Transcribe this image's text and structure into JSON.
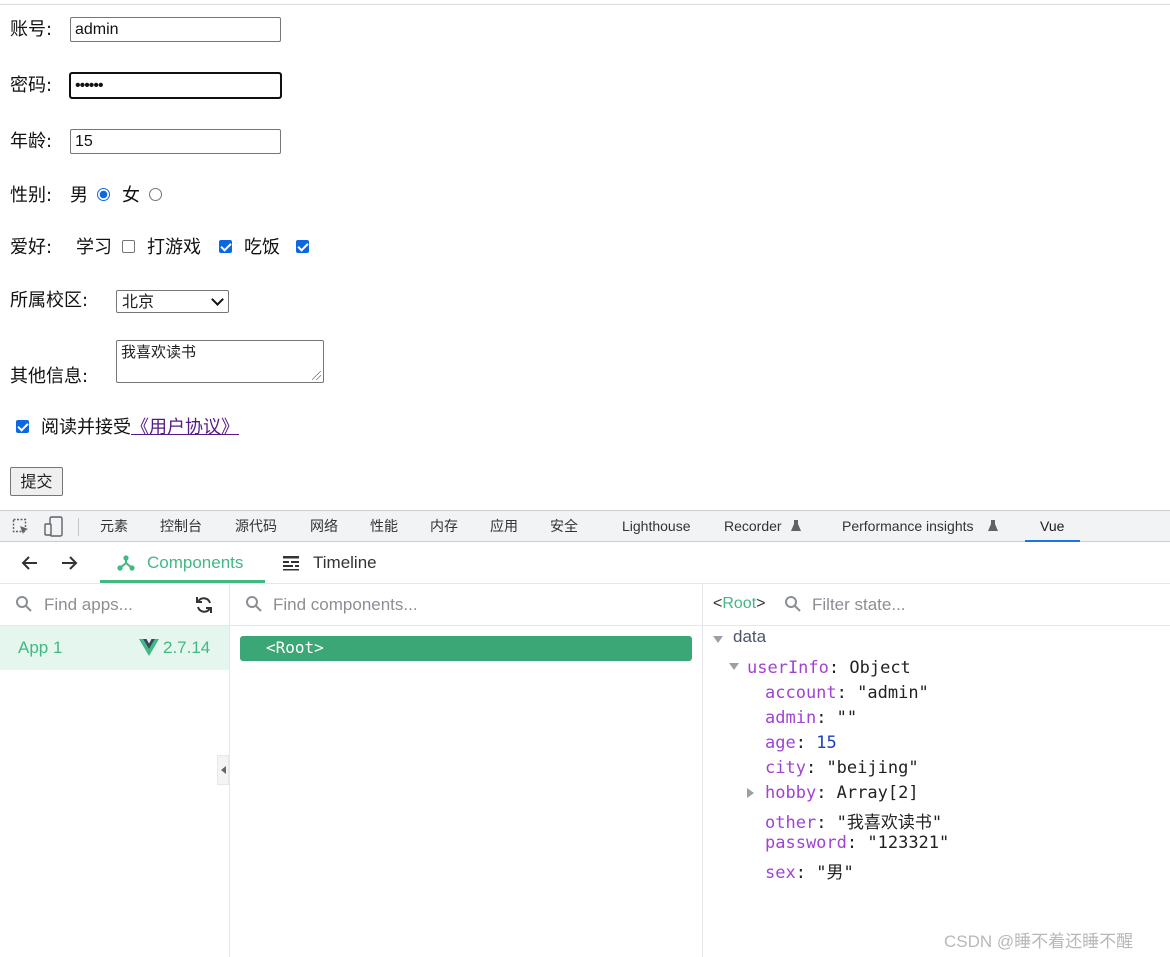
{
  "form": {
    "account_label": "账号:",
    "account_value": "admin",
    "password_label": "密码:",
    "password_value": "••••••",
    "age_label": "年龄:",
    "age_value": "15",
    "sex_label": "性别:",
    "sex_options": [
      "男",
      "女"
    ],
    "sex_selected": "男",
    "hobby_label": "爱好:",
    "hobby_options": [
      {
        "label": "学习",
        "checked": false
      },
      {
        "label": "打游戏",
        "checked": true
      },
      {
        "label": "吃饭",
        "checked": true
      }
    ],
    "city_label": "所属校区:",
    "city_value": "北京",
    "other_label": "其他信息:",
    "other_value": "我喜欢读书",
    "agree_text": "阅读并接受",
    "agree_link": "《用户协议》",
    "agree_checked": true,
    "submit_label": "提交"
  },
  "devtools": {
    "tabs": [
      "元素",
      "控制台",
      "源代码",
      "网络",
      "性能",
      "内存",
      "应用",
      "安全",
      "Lighthouse",
      "Recorder",
      "Performance insights",
      "Vue"
    ],
    "active_tab": "Vue"
  },
  "vue": {
    "tabs": [
      "Components",
      "Timeline"
    ],
    "active_tab": "Components",
    "apps_search_placeholder": "Find apps...",
    "app_name": "App 1",
    "app_version": "2.7.14",
    "components_search_placeholder": "Find components...",
    "root_component": "<Root>",
    "selected_component": "Root",
    "state_search_placeholder": "Filter state...",
    "state_section": "data",
    "state_object_key": "userInfo",
    "state_object_type": "Object",
    "state_fields": [
      {
        "key": "account",
        "value": "\"admin\"",
        "kind": "str"
      },
      {
        "key": "admin",
        "value": "\"\"",
        "kind": "str"
      },
      {
        "key": "age",
        "value": "15",
        "kind": "num"
      },
      {
        "key": "city",
        "value": "\"beijing\"",
        "kind": "str"
      },
      {
        "key": "hobby",
        "value": "Array[2]",
        "kind": "arr"
      },
      {
        "key": "other",
        "value": "\"我喜欢读书\"",
        "kind": "str"
      },
      {
        "key": "password",
        "value": "\"123321\"",
        "kind": "str"
      },
      {
        "key": "sex",
        "value": "\"男\"",
        "kind": "str"
      }
    ]
  },
  "watermark": "CSDN @睡不着还睡不醒",
  "colors": {
    "vue_green": "#42b883",
    "root_bg": "#3ba776",
    "link": "#551a8b",
    "checkbox": "#0b68e1",
    "key": "#a242d4"
  }
}
